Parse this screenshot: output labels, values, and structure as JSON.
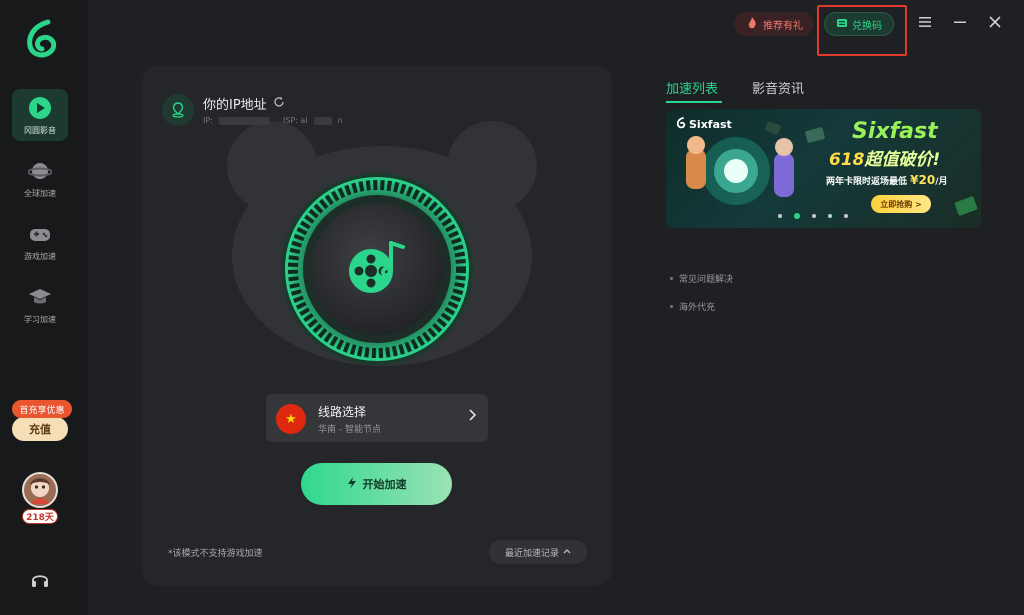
{
  "sidebar": {
    "items": [
      {
        "label": "冈圆影音",
        "icon": "film-play-icon",
        "active": true
      },
      {
        "label": "全球加速",
        "icon": "planet-icon",
        "active": false
      },
      {
        "label": "游戏加速",
        "icon": "gamepad-icon",
        "active": false
      },
      {
        "label": "学习加速",
        "icon": "graduation-cap-icon",
        "active": false
      }
    ],
    "promo_tag": "首充享优惠",
    "recharge_label": "充值",
    "avatar_days": "218天",
    "support_icon": "headset-icon"
  },
  "header": {
    "gift_label": "推荐有礼",
    "redeem_label": "兑换码",
    "menu_icon": "menu-icon",
    "minimize_icon": "minimize-icon",
    "close_icon": "close-icon"
  },
  "main": {
    "ip_title": "你的IP地址",
    "ip_prefix": "IP:",
    "isp_prefix": "ISP: al",
    "isp_suffix": "n",
    "route": {
      "title": "线路选择",
      "subtitle": "华南 - 智能节点",
      "flag_symbol": "★"
    },
    "start_label": "开始加速",
    "note": "*该模式不支持游戏加速",
    "recent_label": "最近加速记录"
  },
  "right": {
    "tabs": [
      {
        "label": "加速列表",
        "active": true
      },
      {
        "label": "影音资讯",
        "active": false
      }
    ],
    "banner": {
      "brand": "Sixfast",
      "title_line1": "Sixfast",
      "title_618": "618",
      "title_line2": "超值破价!",
      "promo_text": "两年卡限时返场最低",
      "promo_price": "¥20",
      "promo_unit": "/月",
      "buy_label": "立即抢购 >",
      "slide_count": 5,
      "active_slide": 1
    },
    "links": [
      {
        "label": "常见问题解决"
      },
      {
        "label": "海外代充"
      }
    ]
  },
  "colors": {
    "accent": "#2bd68c",
    "background": "#1f2023",
    "sidebar": "#18191b",
    "card": "#252629",
    "highlight_box": "#e03a2b"
  }
}
